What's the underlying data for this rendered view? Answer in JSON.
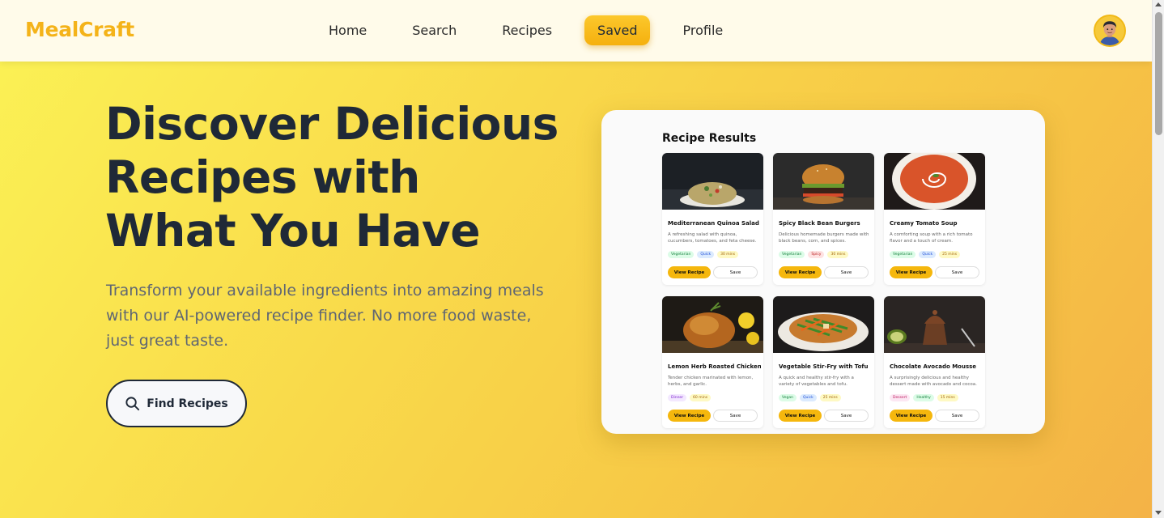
{
  "brand": {
    "name": "MealCraft",
    "color": "#f4b31a"
  },
  "nav": {
    "items": [
      {
        "label": "Home",
        "active": false
      },
      {
        "label": "Search",
        "active": false
      },
      {
        "label": "Recipes",
        "active": false
      },
      {
        "label": "Saved",
        "active": true
      },
      {
        "label": "Profile",
        "active": false
      }
    ]
  },
  "user": {
    "avatar_icon": "user-avatar-icon"
  },
  "hero": {
    "title": "Discover Delicious Recipes with What You Have",
    "subtitle": "Transform your available ingredients into amazing meals with our AI-powered recipe finder. No more food waste, just great taste.",
    "cta_label": "Find Recipes",
    "cta_icon": "search-icon"
  },
  "preview": {
    "title": "Recipe Results",
    "cards": [
      {
        "name": "Mediterranean Quinoa Salad",
        "description": "A refreshing salad with quinoa, cucumbers, tomatoes, and feta cheese.",
        "tags": [
          {
            "label": "Vegetarian",
            "bg": "#dcfce7",
            "fg": "#15803d"
          },
          {
            "label": "Quick",
            "bg": "#dbeafe",
            "fg": "#1d4ed8"
          },
          {
            "label": "30 mins",
            "bg": "#fef9c3",
            "fg": "#a16207"
          }
        ],
        "view_label": "View Recipe",
        "save_label": "Save",
        "image_icon": "quinoa-salad-image"
      },
      {
        "name": "Spicy Black Bean Burgers",
        "description": "Delicious homemade burgers made with black beans, corn, and spices.",
        "tags": [
          {
            "label": "Vegetarian",
            "bg": "#dcfce7",
            "fg": "#15803d"
          },
          {
            "label": "Spicy",
            "bg": "#fee2e2",
            "fg": "#b91c1c"
          },
          {
            "label": "30 mins",
            "bg": "#fef9c3",
            "fg": "#a16207"
          }
        ],
        "view_label": "View Recipe",
        "save_label": "Save",
        "image_icon": "burger-image"
      },
      {
        "name": "Creamy Tomato Soup",
        "description": "A comforting soup with a rich tomato flavor and a touch of cream.",
        "tags": [
          {
            "label": "Vegetarian",
            "bg": "#dcfce7",
            "fg": "#15803d"
          },
          {
            "label": "Quick",
            "bg": "#dbeafe",
            "fg": "#1d4ed8"
          },
          {
            "label": "25 mins",
            "bg": "#fef9c3",
            "fg": "#a16207"
          }
        ],
        "view_label": "View Recipe",
        "save_label": "Save",
        "image_icon": "tomato-soup-image"
      },
      {
        "name": "Lemon Herb Roasted Chicken",
        "description": "Tender chicken marinated with lemon, herbs, and garlic.",
        "tags": [
          {
            "label": "Dinner",
            "bg": "#f3e8ff",
            "fg": "#7e22ce"
          },
          {
            "label": "60 mins",
            "bg": "#fef9c3",
            "fg": "#a16207"
          }
        ],
        "view_label": "View Recipe",
        "save_label": "Save",
        "image_icon": "roasted-chicken-image"
      },
      {
        "name": "Vegetable Stir-Fry with Tofu",
        "description": "A quick and healthy stir-fry with a variety of vegetables and tofu.",
        "tags": [
          {
            "label": "Vegan",
            "bg": "#dcfce7",
            "fg": "#15803d"
          },
          {
            "label": "Quick",
            "bg": "#dbeafe",
            "fg": "#1d4ed8"
          },
          {
            "label": "25 mins",
            "bg": "#fef9c3",
            "fg": "#a16207"
          }
        ],
        "view_label": "View Recipe",
        "save_label": "Save",
        "image_icon": "stir-fry-image"
      },
      {
        "name": "Chocolate Avocado Mousse",
        "description": "A surprisingly delicious and healthy dessert made with avocado and cocoa.",
        "tags": [
          {
            "label": "Dessert",
            "bg": "#fce7f3",
            "fg": "#be185d"
          },
          {
            "label": "Healthy",
            "bg": "#dcfce7",
            "fg": "#15803d"
          },
          {
            "label": "15 mins",
            "bg": "#fef9c3",
            "fg": "#a16207"
          }
        ],
        "view_label": "View Recipe",
        "save_label": "Save",
        "image_icon": "chocolate-mousse-image"
      }
    ]
  }
}
